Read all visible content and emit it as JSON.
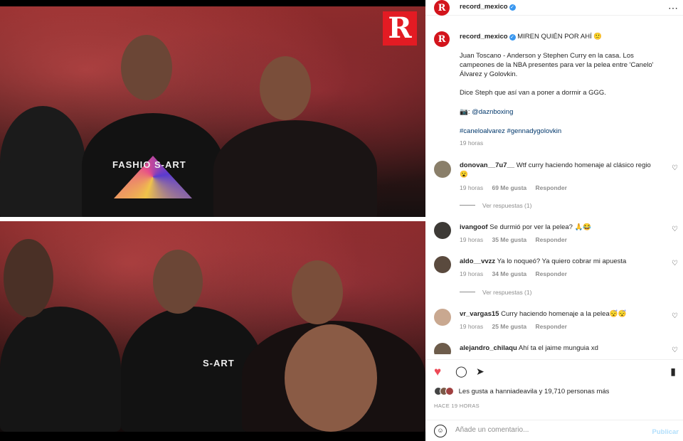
{
  "post": {
    "username": "record_mexico",
    "more_icon": "⋯",
    "logo_letter": "R",
    "shirt_text_top": "FASHIO  S-ART",
    "shirt_text_bottom": "S-ART"
  },
  "caption": {
    "author": "record_mexico",
    "headline": "MIREN QUIÉN POR AHÍ 🙂",
    "line1": "Juan Toscano - Anderson y Stephen Curry en la casa. Los",
    "line2": "campeones de la NBA presentes para ver la pelea entre 'Canelo'",
    "line3": "Álvarez y Golovkin.",
    "line4": "Dice Steph que así van a poner a dormir a GGG.",
    "credit_prefix": "📷:",
    "credit_mention": "@daznboxing",
    "hashtags": "#canelo​alvarez #gennadygolovkin",
    "time": "19 horas"
  },
  "comments": [
    {
      "user": "donovan__7u7__",
      "text": "Wtf curry haciendo homenaje al clásico regio",
      "text2": "😮",
      "time": "19 horas",
      "likes": "69 Me gusta",
      "reply": "Responder",
      "replies": "Ver respuestas (1)",
      "avatar_color": "#8a7f6a"
    },
    {
      "user": "ivangoof",
      "text": "Se durmió por ver la pelea? 🙏😂",
      "time": "19 horas",
      "likes": "35 Me gusta",
      "reply": "Responder",
      "avatar_color": "#3d3a36"
    },
    {
      "user": "aldo__vvzz",
      "text": "Ya lo noqueó? Ya quiero cobrar mi apuesta",
      "time": "19 horas",
      "likes": "34 Me gusta",
      "reply": "Responder",
      "replies": "Ver respuestas (1)",
      "avatar_color": "#5a4a3e"
    },
    {
      "user": "vr_vargas15",
      "text": "Curry haciendo homenaje a la pelea😴😴",
      "time": "19 horas",
      "likes": "25 Me gusta",
      "reply": "Responder",
      "avatar_color": "#c9a890"
    },
    {
      "user": "alejandro_chilaqu",
      "text": "Ahí ta el jaime munguia xd",
      "avatar_color": "#6d5c4b"
    }
  ],
  "actions": {
    "like_icon": "♥",
    "comment_icon": "◯",
    "share_icon": "➤",
    "save_icon": "▮",
    "like_color": "#ed4956"
  },
  "likes": {
    "text": "Les gusta a hanniadeavila y 19,710 personas más"
  },
  "posted": "HACE 19 HORAS",
  "composer": {
    "emoji_icon": "☺",
    "placeholder": "Añade un comentario...",
    "post_label": "Publicar"
  }
}
